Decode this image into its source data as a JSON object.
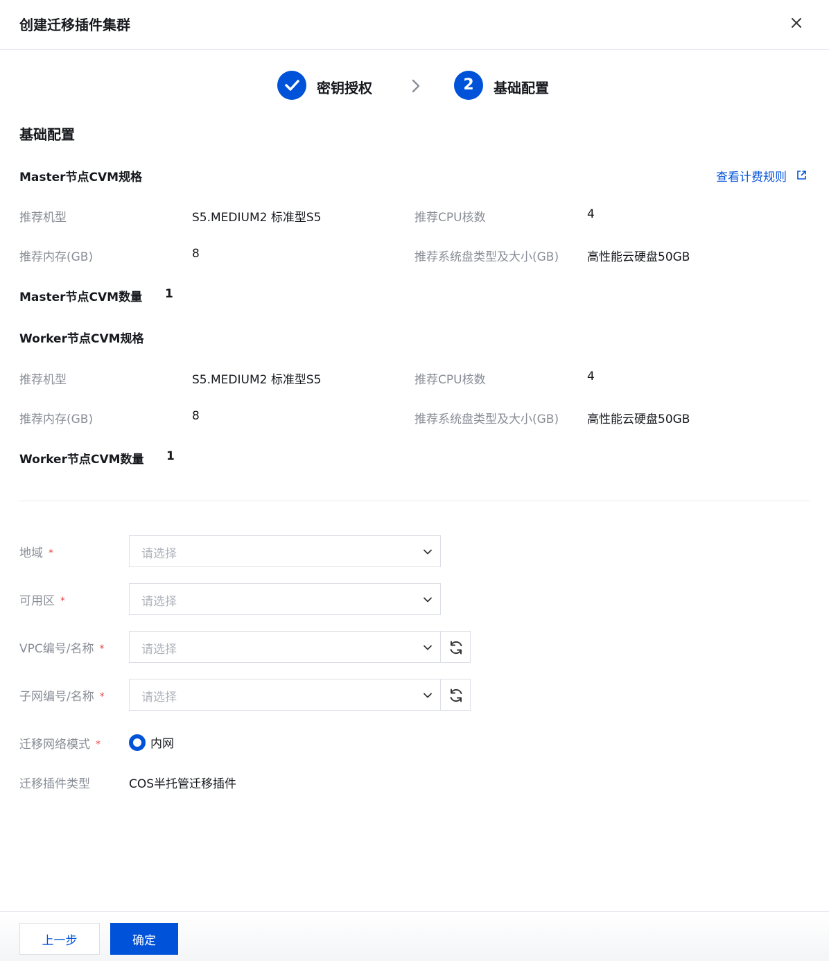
{
  "dialog": {
    "title": "创建迁移插件集群"
  },
  "steps": [
    {
      "label": "密钥授权",
      "status": "done"
    },
    {
      "number": "2",
      "label": "基础配置",
      "status": "current"
    }
  ],
  "section_title": "基础配置",
  "master": {
    "spec_title": "Master节点CVM规格",
    "billing_link": "查看计费规则",
    "fields": [
      {
        "label": "推荐机型",
        "value": "S5.MEDIUM2 标准型S5"
      },
      {
        "label": "推荐CPU核数",
        "value": "4"
      },
      {
        "label": "推荐内存(GB)",
        "value": "8"
      },
      {
        "label": "推荐系统盘类型及大小(GB)",
        "value": "高性能云硬盘50GB"
      }
    ],
    "count_label": "Master节点CVM数量",
    "count_value": "1"
  },
  "worker": {
    "spec_title": "Worker节点CVM规格",
    "fields": [
      {
        "label": "推荐机型",
        "value": "S5.MEDIUM2 标准型S5"
      },
      {
        "label": "推荐CPU核数",
        "value": "4"
      },
      {
        "label": "推荐内存(GB)",
        "value": "8"
      },
      {
        "label": "推荐系统盘类型及大小(GB)",
        "value": "高性能云硬盘50GB"
      }
    ],
    "count_label": "Worker节点CVM数量",
    "count_value": "1"
  },
  "form": {
    "required_mark": "*",
    "placeholder": "请选择",
    "region_label": "地域",
    "zone_label": "可用区",
    "vpc_label": "VPC编号/名称",
    "subnet_label": "子网编号/名称",
    "network_mode_label": "迁移网络模式",
    "network_mode_option": "内网",
    "plugin_type_label": "迁移插件类型",
    "plugin_type_value": "COS半托管迁移插件"
  },
  "footer": {
    "prev_label": "上一步",
    "confirm_label": "确定"
  },
  "colors": {
    "primary": "#0052d9",
    "required": "#e54545",
    "muted": "#888d96"
  }
}
